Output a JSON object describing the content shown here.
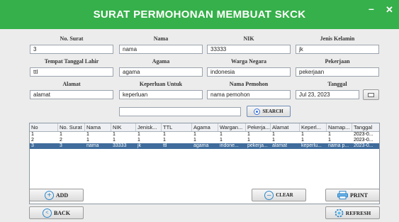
{
  "window": {
    "title": "SURAT PERMOHONAN MEMBUAT SKCK",
    "minimize": "–",
    "close": "✕"
  },
  "form": {
    "no_surat": {
      "label": "No. Surat",
      "value": "3"
    },
    "nama": {
      "label": "Nama",
      "value": "nama"
    },
    "nik": {
      "label": "NIK",
      "value": "33333"
    },
    "jenis_kelamin": {
      "label": "Jenis Kelamin",
      "value": "jk"
    },
    "tempat_tanggal_lahir": {
      "label": "Tempat Tanggal Lahir",
      "value": "ttl"
    },
    "agama": {
      "label": "Agama",
      "value": "agama"
    },
    "warga_negara": {
      "label": "Warga Negara",
      "value": "indonesia"
    },
    "pekerjaan": {
      "label": "Pekerjaan",
      "value": "pekerjaan"
    },
    "alamat": {
      "label": "Alamat",
      "value": "alamat"
    },
    "keperluan_untuk": {
      "label": "Keperluan Untuk",
      "value": "keperluan"
    },
    "nama_pemohon": {
      "label": "Nama Pemohon",
      "value": "nama pemohon"
    },
    "tanggal": {
      "label": "Tanggal",
      "value": "Jul 23, 2023"
    }
  },
  "search": {
    "value": "",
    "button_label": "SEARCH"
  },
  "table": {
    "columns": [
      "No",
      "No. Surat",
      "Nama",
      "NIK",
      "Jenisk...",
      "TTL",
      "Agama",
      "Wargan...",
      "Pekerja...",
      "Alamat",
      "Keperl...",
      "Namap...",
      "Tanggal"
    ],
    "rows": [
      [
        "1",
        "1",
        "1",
        "1",
        "1",
        "1",
        "1",
        "1",
        "1",
        "1",
        "1",
        "1",
        "2023-0..."
      ],
      [
        "2",
        "2",
        "1",
        "1",
        "1",
        "1",
        "1",
        "1",
        "1",
        "1",
        "1",
        "1",
        "2023-0..."
      ],
      [
        "3",
        "3",
        "nama",
        "33333",
        "jk",
        "ttl",
        "agama",
        "indone...",
        "pekerja...",
        "alamat",
        "keperlu...",
        "nama p...",
        "2023-0..."
      ]
    ],
    "selected_row": 2
  },
  "buttons": {
    "add": "ADD",
    "back": "BACK",
    "clear": "CLEAR",
    "print": "PRINT",
    "refresh": "REFRESH"
  },
  "colors": {
    "titlebar": "#36b04a",
    "selection": "#3f6c9c",
    "icon_accent": "#2c86c9"
  },
  "icons": {
    "add": "plus-circle-icon",
    "back": "left-arrow-circle-icon",
    "clear": "minus-circle-icon",
    "print": "printer-icon",
    "refresh": "refresh-icon",
    "calendar": "calendar-icon",
    "search": "search-dot-icon"
  }
}
